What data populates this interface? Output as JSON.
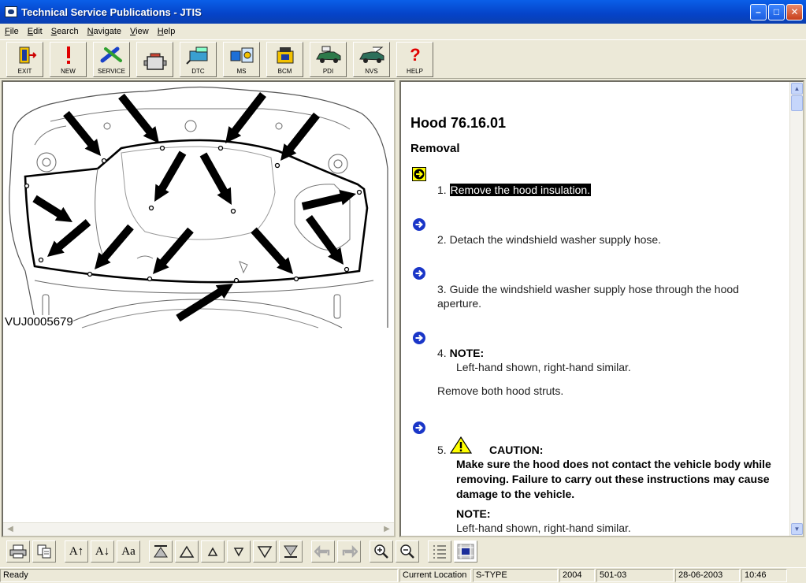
{
  "window": {
    "title": "Technical Service Publications - JTIS"
  },
  "menu": [
    "File",
    "Edit",
    "Search",
    "Navigate",
    "View",
    "Help"
  ],
  "toolbar": [
    {
      "label": "EXIT",
      "icon": "exit-icon"
    },
    {
      "label": "NEW",
      "icon": "new-icon"
    },
    {
      "label": "SERVICE",
      "icon": "service-icon"
    },
    {
      "label": "",
      "icon": "engine-icon"
    },
    {
      "label": "DTC",
      "icon": "dtc-icon"
    },
    {
      "label": "MS",
      "icon": "ms-icon"
    },
    {
      "label": "BCM",
      "icon": "bcm-icon"
    },
    {
      "label": "PDI",
      "icon": "pdi-icon"
    },
    {
      "label": "NVS",
      "icon": "nvs-icon"
    },
    {
      "label": "HELP",
      "icon": "help-icon"
    }
  ],
  "diagram": {
    "code": "VUJ0005679"
  },
  "content": {
    "title": "Hood 76.16.01",
    "section": "Removal",
    "step1": {
      "num": "1.",
      "text": "Remove the hood insulation."
    },
    "step2": {
      "num": "2.",
      "text": "Detach the windshield washer supply hose."
    },
    "step3": {
      "num": "3.",
      "text": "Guide the windshield washer supply hose through the hood aperture."
    },
    "step4": {
      "num": "4.",
      "note_label": "NOTE:",
      "note_text": "Left-hand shown, right-hand similar.",
      "text": "Remove both hood struts."
    },
    "step5": {
      "num": "5.",
      "caution_label": "CAUTION:",
      "caution_text": "Make sure the hood does not contact the vehicle body while removing. Failure to carry out these instructions may cause damage to the vehicle.",
      "note_label": "NOTE:",
      "note_text": "Left-hand shown, right-hand similar."
    }
  },
  "statusbar": {
    "status": "Ready",
    "location_label": "Current Location",
    "model": "S-TYPE",
    "year": "2004",
    "code": "501-03",
    "date": "28-06-2003",
    "time": "10:46"
  },
  "colors": {
    "titlebar": "#0a5fe8",
    "step_highlight": "#ffff00",
    "step_arrow": "#1a36c8"
  }
}
